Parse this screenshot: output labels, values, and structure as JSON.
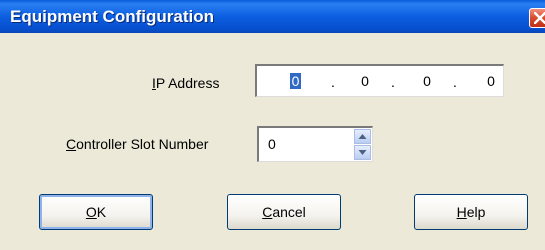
{
  "window": {
    "title": "Equipment Configuration"
  },
  "fields": {
    "ip_label_mnemonic": "I",
    "ip_label_rest": "P Address",
    "ip_octets": [
      "0",
      "0",
      "0",
      "0"
    ],
    "ip_separator": ".",
    "slot_label_mnemonic": "C",
    "slot_label_rest": "ontroller Slot Number",
    "slot_value": "0"
  },
  "buttons": {
    "ok_mnemonic": "O",
    "ok_rest": "K",
    "cancel_mnemonic": "C",
    "cancel_rest": "ancel",
    "help_mnemonic": "H",
    "help_rest": "elp"
  },
  "icons": {
    "close": "close-icon",
    "spin_up": "triangle-up-icon",
    "spin_down": "triangle-down-icon"
  },
  "colors": {
    "titlebar": "#0c5fe0",
    "close_button": "#d84a2c",
    "dialog_background": "#ece9d8",
    "selection": "#316ac5"
  }
}
